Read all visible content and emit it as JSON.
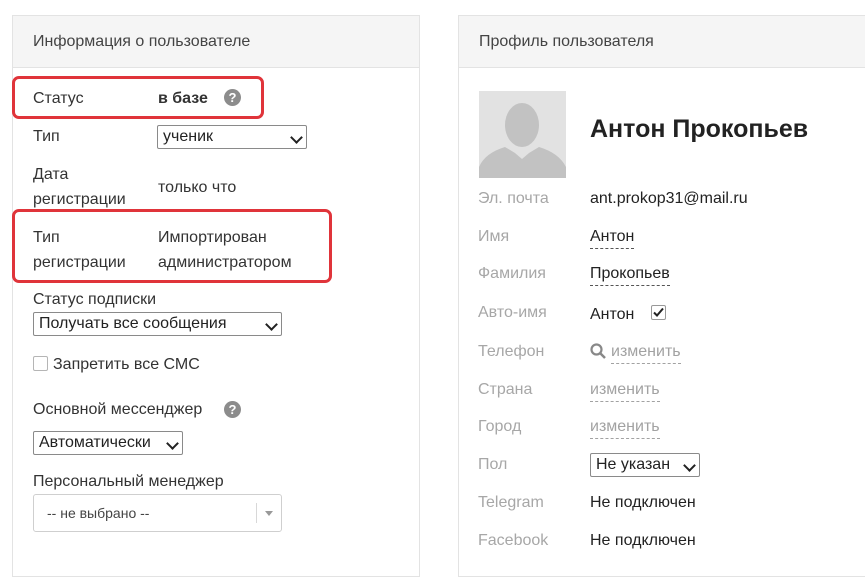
{
  "left_panel": {
    "title": "Информация о пользователе",
    "status_label": "Статус",
    "status_value": "в базе",
    "help_glyph": "?",
    "type_label": "Тип",
    "type_value": "ученик",
    "reg_date_label_1": "Дата",
    "reg_date_label_2": "регистрации",
    "reg_date_value": "только что",
    "reg_type_label_1": "Тип",
    "reg_type_label_2": "регистрации",
    "reg_type_value_1": "Импортирован",
    "reg_type_value_2": "администратором",
    "subscription_label": "Статус подписки",
    "subscription_value": "Получать все сообщения",
    "block_sms_label": "Запретить все СМС",
    "block_sms_checked": false,
    "messenger_label": "Основной мессенджер",
    "messenger_value": "Автоматически",
    "manager_label": "Персональный менеджер",
    "manager_value": "-- не выбрано --"
  },
  "right_panel": {
    "title": "Профиль пользователя",
    "full_name": "Антон Прокопьев",
    "fields": {
      "email_label": "Эл. почта",
      "email_value": "ant.prokop31@mail.ru",
      "first_name_label": "Имя",
      "first_name_value": "Антон",
      "last_name_label": "Фамилия",
      "last_name_value": "Прокопьев",
      "auto_name_label": "Авто-имя",
      "auto_name_value": "Антон",
      "auto_name_checked": true,
      "phone_label": "Телефон",
      "phone_action": "изменить",
      "country_label": "Страна",
      "country_action": "изменить",
      "city_label": "Город",
      "city_action": "изменить",
      "gender_label": "Пол",
      "gender_value": "Не указан",
      "telegram_label": "Telegram",
      "telegram_value": "Не подключен",
      "facebook_label": "Facebook",
      "facebook_value": "Не подключен"
    }
  },
  "colors": {
    "highlight_border": "#e0343a",
    "header_bg": "#f5f5f5",
    "muted_label": "#a7a7a7"
  }
}
